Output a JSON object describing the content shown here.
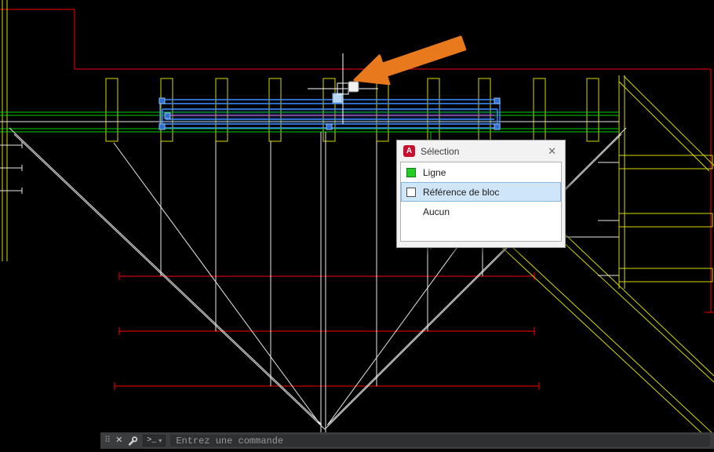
{
  "palette": {
    "background": "#000000",
    "line_red": "#ff0000",
    "line_yellow": "#d8d800",
    "line_green": "#00d400",
    "line_white": "#e9e9e9",
    "selection_blue": "#3c8dff",
    "selection_magenta": "#c05ad6",
    "grip_blue": "#2d6fd2",
    "arrow_orange": "#e87a1d",
    "row_highlight": "#cfe6f8",
    "autocad_red": "#c8102e"
  },
  "dialog": {
    "title": "Sélection",
    "badge_letter": "A",
    "close_glyph": "✕",
    "items": [
      {
        "label": "Ligne",
        "swatch": "green",
        "selected": false
      },
      {
        "label": "Référence de bloc",
        "swatch": "white",
        "selected": true
      },
      {
        "label": "Aucun",
        "swatch": "none",
        "selected": false
      }
    ]
  },
  "command_bar": {
    "grip_glyph": "⠿",
    "close_glyph": "✕",
    "prompt_glyph": ">_",
    "dropdown_glyph": "▾",
    "placeholder": "Entrez une commande"
  }
}
